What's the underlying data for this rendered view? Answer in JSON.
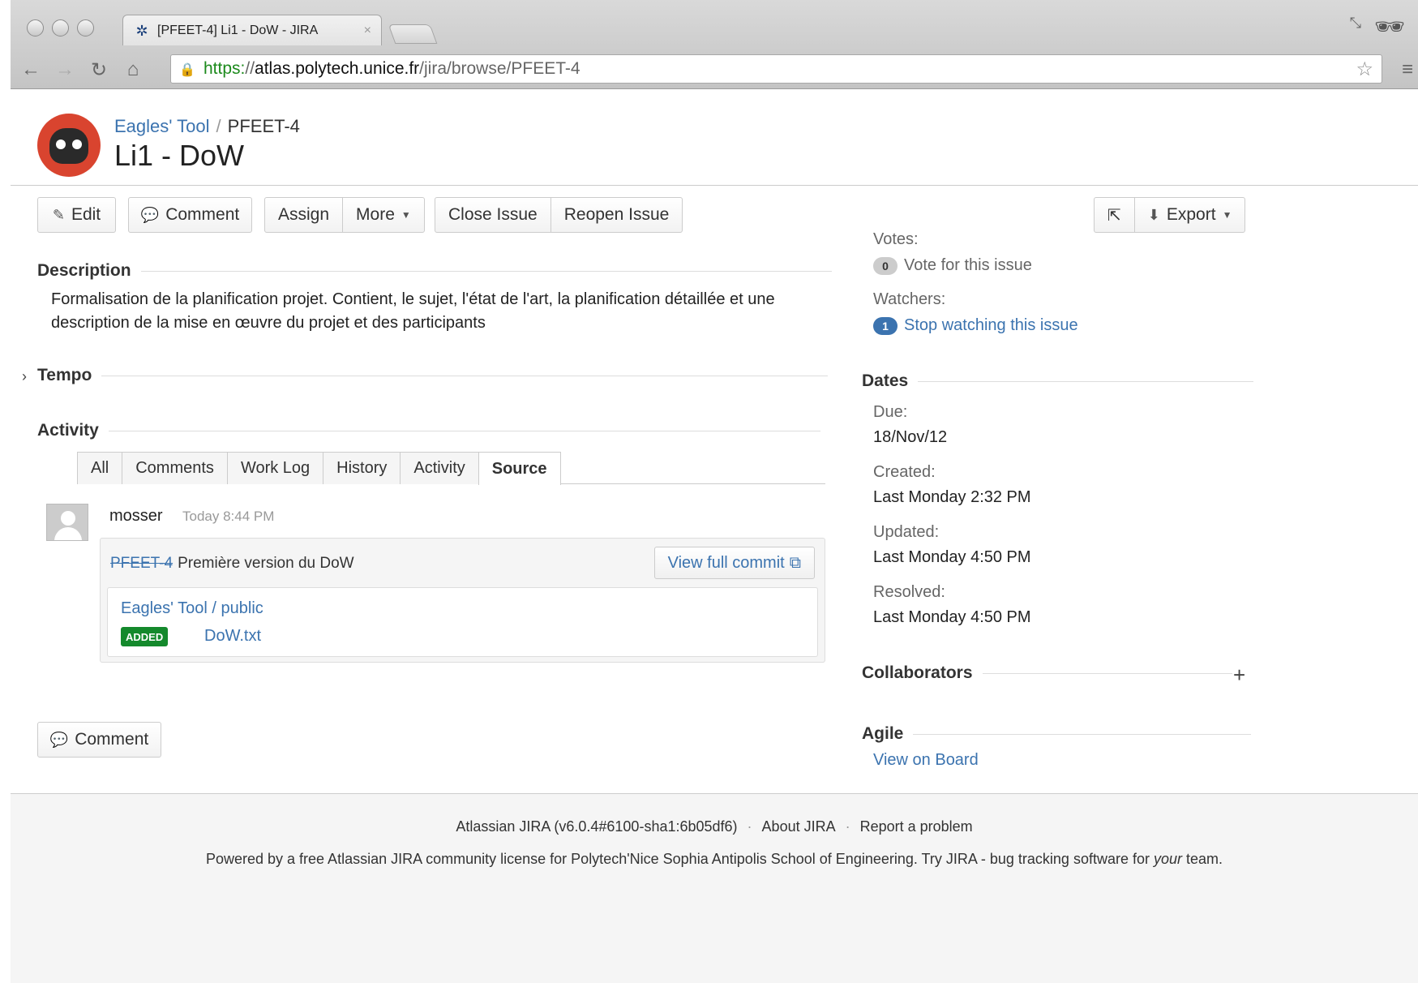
{
  "browser": {
    "tab_title": "[PFEET-4] Li1 - DoW - JIRA",
    "tab_close": "×",
    "url_scheme": "https:",
    "url_slashes": "//",
    "url_host": "atlas.polytech.unice.fr",
    "url_path": "/jira/browse/PFEET-4",
    "icons": [
      "back-icon",
      "forward-icon",
      "reload-icon",
      "home-icon",
      "lock-icon",
      "bookmark-star-icon",
      "menu-icon",
      "incognito-icon"
    ]
  },
  "issue": {
    "project_name": "Eagles' Tool",
    "breadcrumb_sep": "/",
    "key": "PFEET-4",
    "title": "Li1 - DoW"
  },
  "actions": {
    "edit": "Edit",
    "comment": "Comment",
    "assign": "Assign",
    "more": "More",
    "close_issue": "Close Issue",
    "reopen_issue": "Reopen Issue",
    "export": "Export"
  },
  "description": {
    "heading": "Description",
    "text": "Formalisation de la planification projet. Contient, le sujet, l'état de l'art, la planification détaillée et une description de la mise en œuvre du projet et des participants"
  },
  "tempo": {
    "heading": "Tempo"
  },
  "activity": {
    "heading": "Activity",
    "tabs": [
      {
        "label": "All",
        "active": false
      },
      {
        "label": "Comments",
        "active": false
      },
      {
        "label": "Work Log",
        "active": false
      },
      {
        "label": "History",
        "active": false
      },
      {
        "label": "Activity",
        "active": false
      },
      {
        "label": "Source",
        "active": true
      }
    ],
    "commit": {
      "user": "mosser",
      "time": "Today 8:44 PM",
      "issue_key": "PFEET-4",
      "message": "Première version du DoW",
      "view_full_commit": "View full commit",
      "repo": "Eagles' Tool / public",
      "file_status": "ADDED",
      "file_name": "DoW.txt"
    },
    "comment_button": "Comment"
  },
  "people": {
    "votes_label": "Votes:",
    "votes_count": "0",
    "vote_action": "Vote for this issue",
    "watchers_label": "Watchers:",
    "watchers_count": "1",
    "watch_action": "Stop watching this issue"
  },
  "dates": {
    "heading": "Dates",
    "due_label": "Due:",
    "due": "18/Nov/12",
    "created_label": "Created:",
    "created": "Last Monday 2:32 PM",
    "updated_label": "Updated:",
    "updated": "Last Monday 4:50 PM",
    "resolved_label": "Resolved:",
    "resolved": "Last Monday 4:50 PM"
  },
  "collaborators": {
    "heading": "Collaborators",
    "add_symbol": "+"
  },
  "agile": {
    "heading": "Agile",
    "view_on_board": "View on Board"
  },
  "footer": {
    "version": "Atlassian JIRA (v6.0.4#6100-sha1:6b05df6)",
    "sep": "·",
    "about": "About JIRA",
    "report": "Report a problem",
    "powered_prefix": "Powered by a free Atlassian JIRA community license for Polytech'Nice Sophia Antipolis School of Engineering. Try JIRA - bug tracking software for ",
    "powered_em": "your",
    "powered_suffix": " team."
  },
  "colors": {
    "link": "#3b73af",
    "added_badge": "#14892c",
    "project_avatar": "#d9442f"
  }
}
